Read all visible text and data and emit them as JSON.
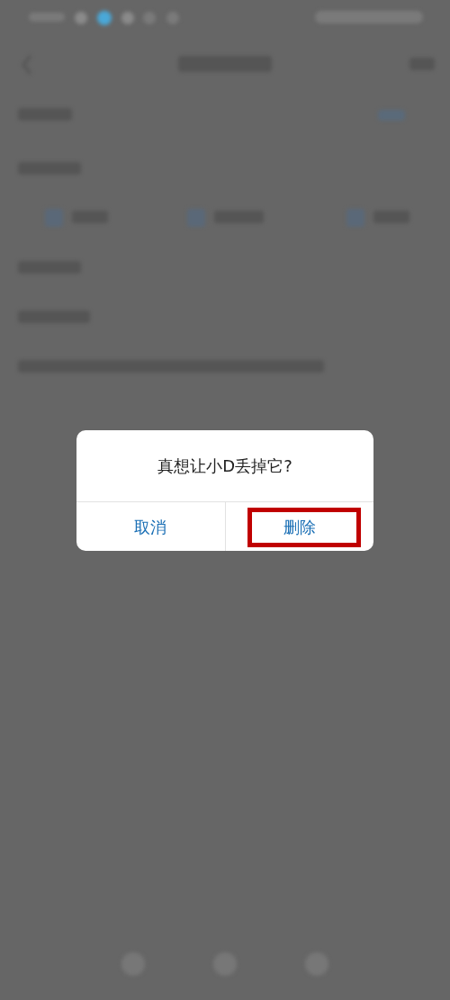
{
  "dialog": {
    "message": "真想让小D丢掉它?",
    "buttons": [
      {
        "label": "取消",
        "highlighted": false
      },
      {
        "label": "删除",
        "highlighted": true
      }
    ]
  }
}
